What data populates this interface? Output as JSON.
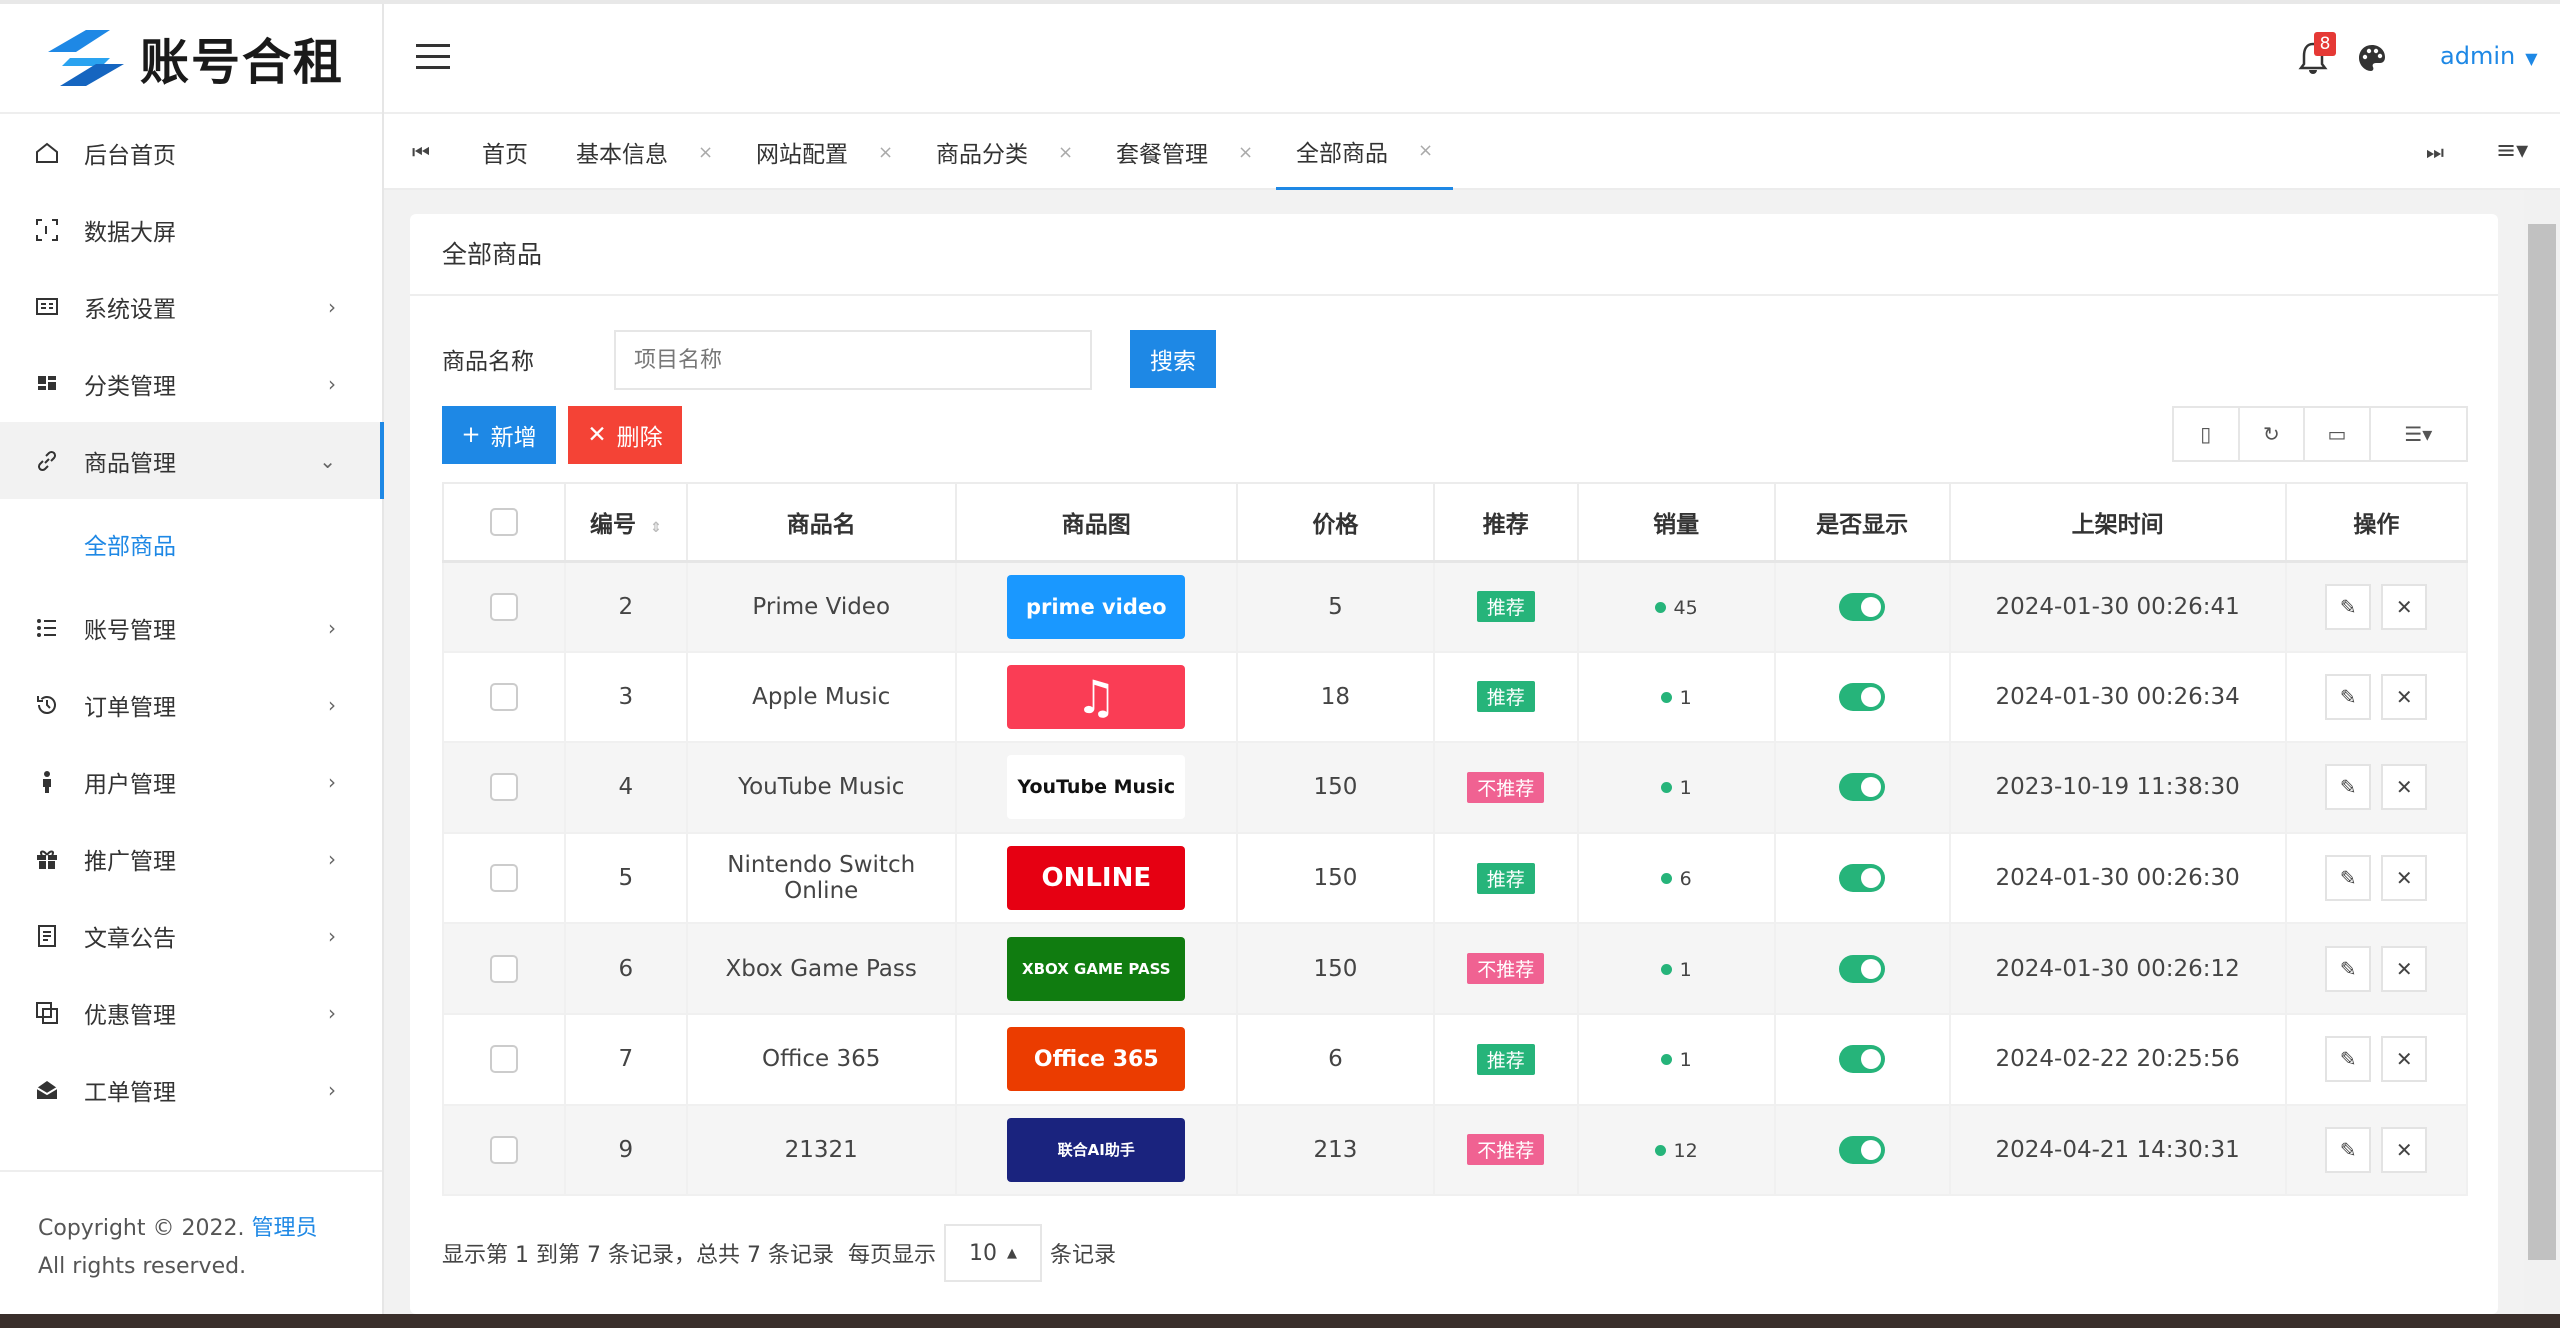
{
  "brand": {
    "name": "账号合租"
  },
  "sidebar": {
    "items": [
      {
        "label": "后台首页"
      },
      {
        "label": "数据大屏"
      },
      {
        "label": "系统设置"
      },
      {
        "label": "分类管理"
      },
      {
        "label": "商品管理"
      },
      {
        "label": "全部商品"
      },
      {
        "label": "账号管理"
      },
      {
        "label": "订单管理"
      },
      {
        "label": "用户管理"
      },
      {
        "label": "推广管理"
      },
      {
        "label": "文章公告"
      },
      {
        "label": "优惠管理"
      },
      {
        "label": "工单管理"
      }
    ],
    "copyright_prefix": "Copyright © 2022. ",
    "copyright_link": "管理员",
    "copyright_suffix": " All rights reserved."
  },
  "header": {
    "notification_count": "8",
    "user": "admin"
  },
  "tabs": [
    "首页",
    "基本信息",
    "网站配置",
    "商品分类",
    "套餐管理",
    "全部商品"
  ],
  "card": {
    "title": "全部商品"
  },
  "search": {
    "label": "商品名称",
    "placeholder": "项目名称",
    "button": "搜索"
  },
  "actions": {
    "add": "新增",
    "delete": "删除"
  },
  "table": {
    "headers": [
      "编号",
      "商品名",
      "商品图",
      "价格",
      "推荐",
      "销量",
      "是否显示",
      "上架时间",
      "操作"
    ],
    "rows": [
      {
        "id": "2",
        "name": "Prime Video",
        "img": "prime video",
        "price": "5",
        "rec": "推荐",
        "sales": "45",
        "time": "2024-01-30 00:26:41"
      },
      {
        "id": "3",
        "name": "Apple Music",
        "img": "♫",
        "price": "18",
        "rec": "推荐",
        "sales": "1",
        "time": "2024-01-30 00:26:34"
      },
      {
        "id": "4",
        "name": "YouTube Music",
        "img": "YouTube Music",
        "price": "150",
        "rec": "不推荐",
        "sales": "1",
        "time": "2023-10-19 11:38:30"
      },
      {
        "id": "5",
        "name": "Nintendo Switch Online",
        "img": "ONLINE",
        "price": "150",
        "rec": "推荐",
        "sales": "6",
        "time": "2024-01-30 00:26:30"
      },
      {
        "id": "6",
        "name": "Xbox Game Pass",
        "img": "XBOX GAME PASS",
        "price": "150",
        "rec": "不推荐",
        "sales": "1",
        "time": "2024-01-30 00:26:12"
      },
      {
        "id": "7",
        "name": "Office 365",
        "img": "Office 365",
        "price": "6",
        "rec": "推荐",
        "sales": "1",
        "time": "2024-02-22 20:25:56"
      },
      {
        "id": "9",
        "name": "21321",
        "img": "联合AI助手",
        "price": "213",
        "rec": "不推荐",
        "sales": "12",
        "time": "2024-04-21 14:30:31"
      }
    ]
  },
  "pagination": {
    "info": "显示第 1 到第 7 条记录，总共 7 条记录",
    "per_page_prefix": "每页显示",
    "per_page": "10",
    "per_page_suffix": "条记录"
  },
  "colors": {
    "accent": "#1e88e5",
    "danger": "#f44336",
    "success": "#26b47a",
    "not_recommended": "#f06292"
  }
}
